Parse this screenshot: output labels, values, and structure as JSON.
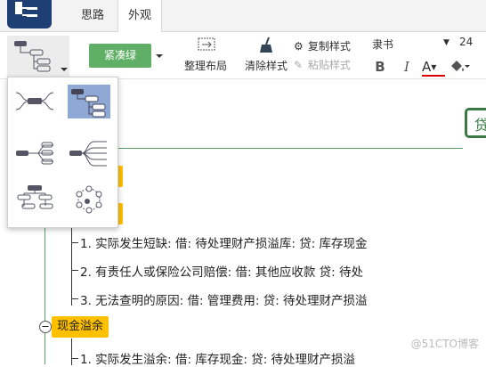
{
  "tabs": [
    {
      "label": "思路"
    },
    {
      "label": "外观"
    }
  ],
  "toolbar": {
    "theme_label": "紧凑绿",
    "layout_label": "整理布局",
    "clear_label": "清除样式",
    "copy_label": "复制样式",
    "paste_label": "粘贴样式",
    "font_name": "隶书",
    "font_size": "24",
    "bold": "B",
    "italic": "I",
    "font_color": "A"
  },
  "mindmap": {
    "group1_leaves": [
      "1. 实际发生短缺: 借: 待处理财产损溢库: 贷: 库存现金",
      "2. 有责任人或保险公司赔偿: 借: 其他应收款  贷: 待处",
      "3. 无法查明的原因: 借: 管理费用: 贷: 待处理财产损溢"
    ],
    "group2_title": "现金溢余",
    "group2_leaves": [
      "1. 实际发生溢余: 借: 库存现金: 贷: 待处理财产损溢"
    ],
    "collapse_symbol": "−",
    "root_partial": "贷"
  },
  "watermark": "@51CTO博客"
}
